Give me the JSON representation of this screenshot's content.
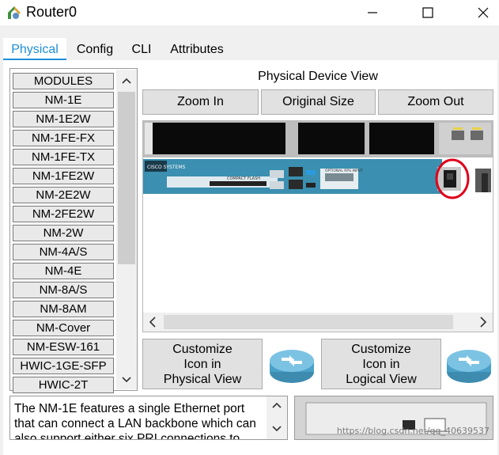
{
  "window": {
    "title": "Router0"
  },
  "tabs": [
    {
      "label": "Physical"
    },
    {
      "label": "Config"
    },
    {
      "label": "CLI"
    },
    {
      "label": "Attributes"
    }
  ],
  "modules": {
    "items": [
      "MODULES",
      "NM-1E",
      "NM-1E2W",
      "NM-1FE-FX",
      "NM-1FE-TX",
      "NM-1FE2W",
      "NM-2E2W",
      "NM-2FE2W",
      "NM-2W",
      "NM-4A/S",
      "NM-4E",
      "NM-8A/S",
      "NM-8AM",
      "NM-Cover",
      "NM-ESW-161",
      "HWIC-1GE-SFP",
      "HWIC-2T"
    ]
  },
  "device_view": {
    "title": "Physical Device View",
    "zoom_in": "Zoom In",
    "original_size": "Original Size",
    "zoom_out": "Zoom Out",
    "chassis_brand": "CISCO SYSTEMS",
    "chassis_label_cf": "COMPACT FLASH",
    "chassis_label_rps": "OPTIONAL RPS INPUT"
  },
  "customize": {
    "physical_line1": "Customize",
    "physical_line2": "Icon in",
    "physical_line3": "Physical View",
    "logical_line1": "Customize",
    "logical_line2": "Icon in",
    "logical_line3": "Logical View"
  },
  "description": {
    "text": "The NM-1E features a single Ethernet port that can connect a LAN backbone which can also support either six PRI connections to"
  },
  "watermark": "https://blog.csdn.net/qq_40639537",
  "colors": {
    "tab_accent": "#1e8fd6",
    "power_highlight": "#e0001a",
    "chassis_blue": "#3b8fb0"
  }
}
